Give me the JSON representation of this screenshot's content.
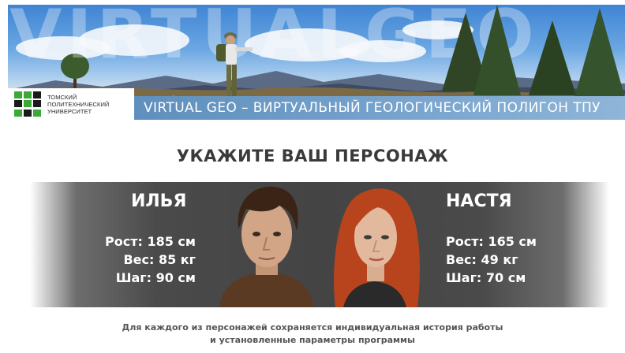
{
  "banner": {
    "background_word": "VIRTUALGEO",
    "logo": {
      "lines": [
        "ТОМСКИЙ",
        "ПОЛИТЕХНИЧЕСКИЙ",
        "УНИВЕРСИТЕТ"
      ],
      "mark_colors": [
        "#3aa935",
        "#3aa935",
        "#1a1a1a",
        "#1a1a1a",
        "#3aa935",
        "#1a1a1a",
        "#3aa935",
        "#1a1a1a",
        "#3aa935"
      ]
    },
    "title": "VIRTUAL GEO – ВИРТУАЛЬНЫЙ ГЕОЛОГИЧЕСКИЙ ПОЛИГОН ТПУ"
  },
  "heading": "УКАЖИТЕ ВАШ ПЕРСОНАЖ",
  "characters": [
    {
      "name": "ИЛЬЯ",
      "height": "Рост: 185 см",
      "weight": "Вес: 85 кг",
      "step": "Шаг: 90 см",
      "hair_color": "#3b2416"
    },
    {
      "name": "НАСТЯ",
      "height": "Рост: 165 см",
      "weight": "Вес: 49 кг",
      "step": "Шаг: 70 см",
      "hair_color": "#b8441e"
    }
  ],
  "footnote": {
    "line1": "Для каждого из персонажей сохраняется индивидуальная история работы",
    "line2": "и установленные параметры программы"
  },
  "colors": {
    "title_bar": "#6f9cc8",
    "heading_text": "#3a3a3a",
    "panel": "#444444",
    "footnote_text": "#555555"
  }
}
